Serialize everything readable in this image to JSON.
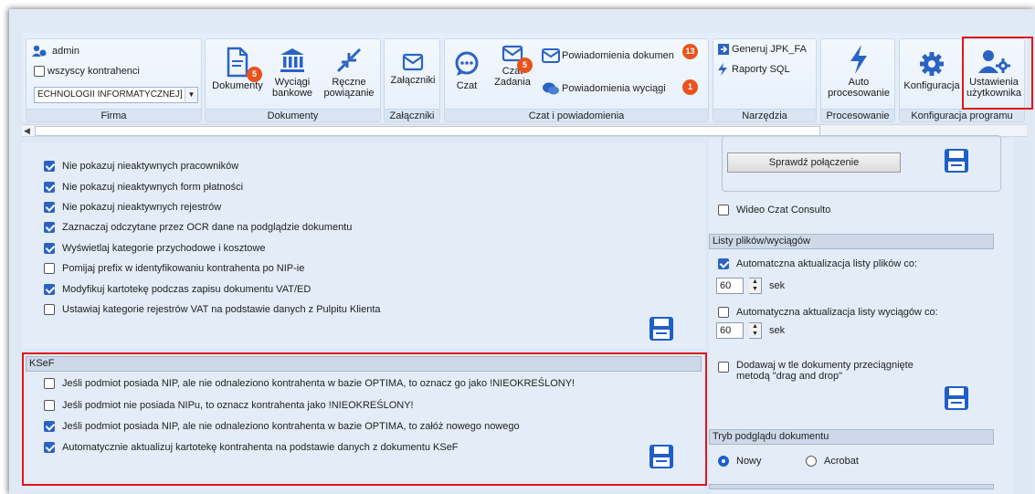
{
  "ribbon": {
    "firma": {
      "user": "admin",
      "all_contractors": "wszyscy kontrahenci",
      "company_value": "ECHNOLOGII INFORMATYCZNEJ]",
      "label": "Firma"
    },
    "dokumenty": {
      "documents": "Dokumenty",
      "documents_badge": "5",
      "bank_line1": "Wyciągi",
      "bank_line2": "bankowe",
      "manual_line1": "Ręczne",
      "manual_line2": "powiązanie",
      "label": "Dokumenty"
    },
    "zalaczniki": {
      "attachments": "Załączniki",
      "label": "Załączniki"
    },
    "czat": {
      "chat": "Czat",
      "task_chat_line1": "Czat",
      "task_chat_line2": "Zadania",
      "task_chat_badge": "5",
      "doc_notifications": "Powiadomienia dokumen",
      "doc_notifications_badge": "13",
      "statement_notifications": "Powiadomienia wyciągi",
      "statement_notifications_badge": "1",
      "label": "Czat i powiadomienia"
    },
    "narzedzia": {
      "jpk": "Generuj JPK_FA",
      "sql": "Raporty SQL",
      "label": "Narzędzia"
    },
    "procesowanie": {
      "auto_line1": "Auto",
      "auto_line2": "procesowanie",
      "label": "Procesowanie"
    },
    "konfiguracja": {
      "config": "Konfiguracja",
      "user_settings_line1": "Ustawienia",
      "user_settings_line2": "użytkownika",
      "label": "Konfiguracja programu"
    }
  },
  "left_options": [
    {
      "label": "Nie pokazuj nieaktywnych pracowników",
      "checked": true
    },
    {
      "label": "Nie pokazuj nieaktywnych form płatności",
      "checked": true
    },
    {
      "label": "Nie pokazuj nieaktywnych rejestrów",
      "checked": true
    },
    {
      "label": "Zaznaczaj odczytane przez OCR dane na podglądzie dokumentu",
      "checked": true
    },
    {
      "label": "Wyświetlaj kategorie przychodowe i kosztowe",
      "checked": true
    },
    {
      "label": "Pomijaj prefix w identyfikowaniu kontrahenta po NIP-ie",
      "checked": false
    },
    {
      "label": "Modyfikuj kartotekę podczas zapisu dokumentu VAT/ED",
      "checked": true
    },
    {
      "label": "Ustawiaj kategorie rejestrów VAT na podstawie danych z Pulpitu Klienta",
      "checked": false
    }
  ],
  "ksef": {
    "title": "KSeF",
    "options": [
      {
        "label": "Jeśli podmiot posiada NIP, ale nie odnaleziono kontrahenta w bazie OPTIMA, to oznacz go jako !NIEOKREŚLONY!",
        "checked": false
      },
      {
        "label": "Jeśli podmiot nie posiada NIPu, to oznacz kontrahenta jako !NIEOKREŚLONY!",
        "checked": false
      },
      {
        "label": "Jeśli podmiot posiada NIP, ale nie odnaleziono kontrahenta w bazie OPTIMA, to załóż nowego nowego",
        "checked": true
      },
      {
        "label": "Automatycznie aktualizuj kartotekę kontrahenta na podstawie danych z dokumentu KSeF",
        "checked": true
      }
    ]
  },
  "right": {
    "check_connection": "Sprawdź połączenie",
    "video_chat": "Wideo Czat Consulto",
    "lists_title": "Listy plików/wyciągów",
    "auto_files": "Automatczna aktualizacja listy plików co:",
    "auto_files_value": "60",
    "auto_statements": "Automatyczna aktualizacja listy wyciągów co:",
    "auto_statements_value": "60",
    "sec": "sek",
    "drag_line1": "Dodawaj w tle dokumenty przeciągnięte",
    "drag_line2": "metodą \"drag and drop\"",
    "preview_title": "Tryb podglądu dokumentu",
    "preview_new": "Nowy",
    "preview_acrobat": "Acrobat"
  },
  "colors": {
    "accent": "#2b63c4",
    "badge": "#e8531d",
    "highlight": "#e0161c",
    "save_blue": "#1f5fc8"
  }
}
